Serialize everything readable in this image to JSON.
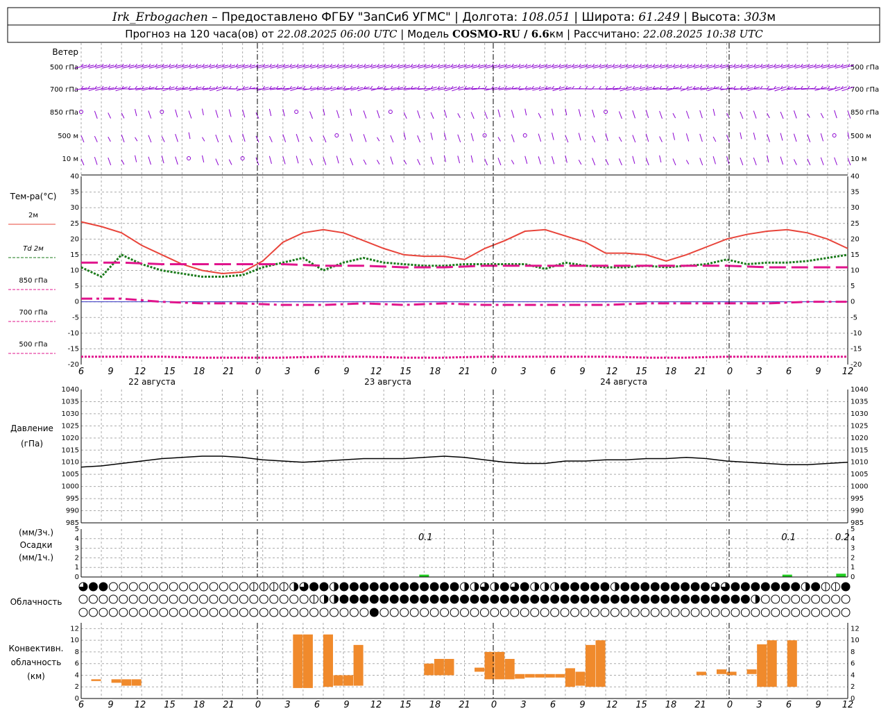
{
  "header": {
    "station": "Irk_Erbogachen",
    "provider": "– Предоставлено ФГБУ \"ЗапСиб УГМС\"",
    "lon_label": "Долгота:",
    "lon": "108.051",
    "lat_label": "Широта:",
    "lat": "61.249",
    "alt_label": "Высота:",
    "alt": "303",
    "alt_unit": "м",
    "fc_prefix": "Прогноз на 120 часа(ов) от",
    "fc_start": "22.08.2025 06:00 UTC",
    "model_label": "| Модель",
    "model": "COSMO-RU / 6.6",
    "model_unit": "км",
    "calc_label": "| Рассчитано:",
    "calc_time": "22.08.2025 10:38 UTC"
  },
  "wind": {
    "title": "Ветер",
    "levels": [
      "500 гПа",
      "700 гПа",
      "850 гПа",
      "500 м",
      "10 м"
    ],
    "color": "#8b00d0"
  },
  "time_axis": {
    "hour_labels": [
      "6",
      "9",
      "12",
      "15",
      "18",
      "21",
      "0",
      "3",
      "6",
      "9",
      "12",
      "15",
      "18",
      "21",
      "0",
      "3",
      "6",
      "9",
      "12",
      "15",
      "18",
      "21",
      "0",
      "3",
      "6",
      "9",
      "12"
    ],
    "day_labels": [
      "22 августа",
      "23 августа",
      "24 августа"
    ]
  },
  "temperature": {
    "title": "Тем-ра(°С)",
    "legend": [
      {
        "label": "2м",
        "color": "#e8443a",
        "style": "solid"
      },
      {
        "label": "Td 2м",
        "color": "#1a7a1a",
        "style": "dotted"
      },
      {
        "label": "850 гПа",
        "color": "#e0148c",
        "style": "long-dash"
      },
      {
        "label": "700 гПа",
        "color": "#e0148c",
        "style": "dash-dot"
      },
      {
        "label": "500 гПа",
        "color": "#e0148c",
        "style": "dotted"
      }
    ],
    "y_ticks": [
      "40",
      "35",
      "30",
      "25",
      "20",
      "15",
      "10",
      "5",
      "0",
      "-5",
      "-10",
      "-15",
      "-20"
    ]
  },
  "pressure": {
    "title_line1": "Давление",
    "title_line2": "(гПа)",
    "y_ticks": [
      "1040",
      "1035",
      "1030",
      "1025",
      "1020",
      "1015",
      "1010",
      "1005",
      "1000",
      "995",
      "990",
      "985"
    ]
  },
  "precip": {
    "title_line1": "(мм/3ч.)",
    "title_line2": "Осадки",
    "title_line3": "(мм/1ч.)",
    "y_ticks": [
      "5",
      "4",
      "3",
      "2",
      "1",
      "0"
    ],
    "annotations": [
      {
        "text": "0.1",
        "hour": 51
      },
      {
        "text": "0.1",
        "hour": 105
      },
      {
        "text": "0.2",
        "hour": 113
      }
    ]
  },
  "clouds": {
    "title": "Облачность"
  },
  "convective": {
    "title_line1": "Конвективн.",
    "title_line2": "облачность",
    "title_line3": "(км)",
    "y_ticks": [
      "12",
      "10",
      "8",
      "6",
      "4",
      "2",
      "0"
    ]
  },
  "chart_data": [
    {
      "type": "line",
      "title": "Тем-ра(°С)",
      "x_unit": "hours from 22.08.2025 06:00 UTC",
      "ylim": [
        -20,
        40
      ],
      "series": [
        {
          "name": "2м",
          "x": [
            0,
            3,
            6,
            9,
            12,
            15,
            18,
            21,
            24,
            27,
            30,
            33,
            36,
            39,
            42,
            45,
            48,
            51,
            54,
            57,
            60,
            63,
            66,
            69,
            72,
            75,
            78,
            81,
            84,
            87,
            90,
            93,
            96,
            99,
            102,
            105,
            108,
            111,
            114
          ],
          "values": [
            25.5,
            24,
            22,
            18,
            15,
            12,
            10,
            9,
            9.5,
            13,
            19,
            22,
            23,
            22,
            19.5,
            17,
            15,
            14.5,
            14.5,
            13.5,
            17,
            19.5,
            22.5,
            23,
            21,
            19,
            15.5,
            15.5,
            15,
            13,
            15,
            17.5,
            20,
            21.5,
            22.5,
            23,
            22,
            20,
            17
          ]
        },
        {
          "name": "Td 2м",
          "x": [
            0,
            3,
            6,
            9,
            12,
            15,
            18,
            21,
            24,
            27,
            30,
            33,
            36,
            39,
            42,
            45,
            48,
            51,
            54,
            57,
            60,
            63,
            66,
            69,
            72,
            75,
            78,
            81,
            84,
            87,
            90,
            93,
            96,
            99,
            102,
            105,
            108,
            111,
            114
          ],
          "values": [
            11,
            8,
            15,
            12,
            10,
            9,
            8,
            8,
            8.5,
            11,
            12.5,
            14,
            10,
            12.5,
            14,
            12.5,
            12,
            11.5,
            11.5,
            12,
            12,
            12,
            12,
            10.5,
            12.5,
            11.5,
            11,
            11,
            11.5,
            11,
            11.5,
            12,
            13.5,
            12,
            12.5,
            12.5,
            13,
            14,
            15
          ]
        },
        {
          "name": "850 гПа",
          "x": [
            0,
            6,
            12,
            18,
            24,
            30,
            36,
            42,
            48,
            54,
            60,
            66,
            72,
            78,
            84,
            90,
            96,
            102,
            108,
            114
          ],
          "values": [
            12.5,
            12.5,
            12,
            12,
            12,
            12,
            11.5,
            11.5,
            11,
            11,
            11.5,
            11.5,
            11.5,
            11.5,
            11.5,
            11.5,
            11.5,
            11,
            11,
            11
          ]
        },
        {
          "name": "700 гПа",
          "x": [
            0,
            6,
            12,
            18,
            24,
            30,
            36,
            42,
            48,
            54,
            60,
            66,
            72,
            78,
            84,
            90,
            96,
            102,
            108,
            114
          ],
          "values": [
            1,
            1,
            0,
            -0.5,
            -0.5,
            -1,
            -1,
            -0.5,
            -1,
            -0.5,
            -1,
            -1,
            -1,
            -1,
            -0.5,
            -0.5,
            -0.5,
            -0.5,
            0,
            0
          ]
        },
        {
          "name": "500 гПа",
          "x": [
            0,
            6,
            12,
            18,
            24,
            30,
            36,
            42,
            48,
            54,
            60,
            66,
            72,
            78,
            84,
            90,
            96,
            102,
            108,
            114
          ],
          "values": [
            -17.5,
            -17.5,
            -17.5,
            -17.8,
            -17.8,
            -17.8,
            -17.5,
            -17.5,
            -17.8,
            -17.8,
            -17.5,
            -17.5,
            -17.5,
            -17.5,
            -17.8,
            -17.8,
            -17.5,
            -17.5,
            -17.5,
            -17.5
          ]
        }
      ]
    },
    {
      "type": "line",
      "title": "Давление (гПа)",
      "ylim": [
        985,
        1040
      ],
      "series": [
        {
          "name": "Давление",
          "x": [
            0,
            3,
            6,
            9,
            12,
            15,
            18,
            21,
            24,
            27,
            30,
            33,
            36,
            39,
            42,
            45,
            48,
            51,
            54,
            57,
            60,
            63,
            66,
            69,
            72,
            75,
            78,
            81,
            84,
            87,
            90,
            93,
            96,
            99,
            102,
            105,
            108,
            111,
            114
          ],
          "values": [
            1008,
            1008.5,
            1009.5,
            1010.5,
            1011.5,
            1012,
            1012.5,
            1012.5,
            1012,
            1011,
            1010.5,
            1010,
            1010.5,
            1011,
            1011.5,
            1011.5,
            1011.5,
            1012,
            1012.5,
            1012,
            1011,
            1010,
            1009.5,
            1009.5,
            1010.5,
            1010.5,
            1011,
            1011,
            1011.5,
            1011.5,
            1012,
            1011.5,
            1010.5,
            1010,
            1009.5,
            1009,
            1009,
            1009.5,
            1010
          ]
        }
      ]
    },
    {
      "type": "bar",
      "title": "Осадки (мм/3ч.) (мм/1ч.)",
      "ylim": [
        0,
        5
      ],
      "x": [
        51,
        105,
        113
      ],
      "values": [
        0.1,
        0.1,
        0.2
      ]
    },
    {
      "type": "bar",
      "title": "Конвективн. облачность (км)",
      "ylim": [
        0,
        12
      ],
      "bars": [
        {
          "x": 1,
          "bottom": 3,
          "top": 3.3
        },
        {
          "x": 3,
          "bottom": 2.7,
          "top": 3.3
        },
        {
          "x": 4,
          "bottom": 2.2,
          "top": 3.3
        },
        {
          "x": 5,
          "bottom": 2.2,
          "top": 3.3
        },
        {
          "x": 21,
          "bottom": 1.8,
          "top": 11
        },
        {
          "x": 22,
          "bottom": 1.8,
          "top": 11
        },
        {
          "x": 24,
          "bottom": 2,
          "top": 11
        },
        {
          "x": 25,
          "bottom": 2.2,
          "top": 4
        },
        {
          "x": 26,
          "bottom": 2.2,
          "top": 4
        },
        {
          "x": 27,
          "bottom": 2.2,
          "top": 9.2
        },
        {
          "x": 34,
          "bottom": 4,
          "top": 6
        },
        {
          "x": 35,
          "bottom": 4,
          "top": 6.8
        },
        {
          "x": 36,
          "bottom": 4,
          "top": 6.8
        },
        {
          "x": 39,
          "bottom": 4.6,
          "top": 5.3
        },
        {
          "x": 40,
          "bottom": 3.3,
          "top": 8
        },
        {
          "x": 41,
          "bottom": 3.3,
          "top": 8
        },
        {
          "x": 42,
          "bottom": 3.3,
          "top": 6.8
        },
        {
          "x": 43,
          "bottom": 3.4,
          "top": 4.2
        },
        {
          "x": 44,
          "bottom": 3.6,
          "top": 4.2
        },
        {
          "x": 45,
          "bottom": 3.6,
          "top": 4.2
        },
        {
          "x": 46,
          "bottom": 3.6,
          "top": 4.2
        },
        {
          "x": 47,
          "bottom": 3.6,
          "top": 4.2
        },
        {
          "x": 48,
          "bottom": 2,
          "top": 5.2
        },
        {
          "x": 49,
          "bottom": 2.2,
          "top": 4.6
        },
        {
          "x": 50,
          "bottom": 2,
          "top": 9.2
        },
        {
          "x": 51,
          "bottom": 2,
          "top": 10
        },
        {
          "x": 61,
          "bottom": 4,
          "top": 4.6
        },
        {
          "x": 63,
          "bottom": 4.2,
          "top": 5
        },
        {
          "x": 64,
          "bottom": 4,
          "top": 4.6
        },
        {
          "x": 66,
          "bottom": 4.2,
          "top": 5
        },
        {
          "x": 67,
          "bottom": 2,
          "top": 9.3
        },
        {
          "x": 68,
          "bottom": 2,
          "top": 10
        },
        {
          "x": 70,
          "bottom": 2,
          "top": 10
        }
      ]
    }
  ]
}
